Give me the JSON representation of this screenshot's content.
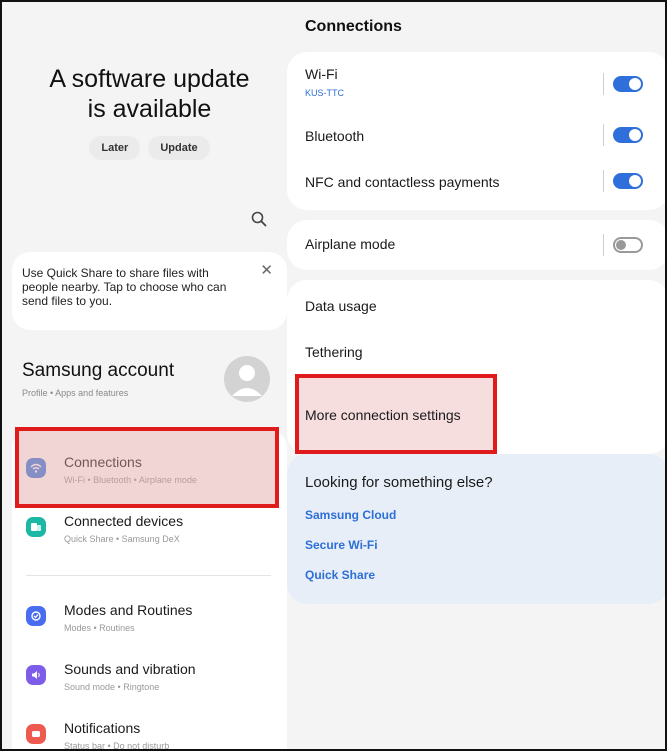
{
  "update": {
    "title_line1": "A software update",
    "title_line2": "is available",
    "later_label": "Later",
    "update_label": "Update"
  },
  "tip": {
    "text": "Use Quick Share to share files with people nearby. Tap to choose who can send files to you.",
    "close": "✕"
  },
  "account": {
    "title": "Samsung account",
    "subtitle": "Profile • Apps and features"
  },
  "settings_items": [
    {
      "title": "Connections",
      "subtitle": "Wi-Fi • Bluetooth • Airplane mode",
      "icon": "wifi-icon",
      "color": "#3b82e6"
    },
    {
      "title": "Connected devices",
      "subtitle": "Quick Share • Samsung DeX",
      "icon": "connected-devices-icon",
      "color": "#1db7a6"
    },
    {
      "title": "Modes and Routines",
      "subtitle": "Modes • Routines",
      "icon": "modes-icon",
      "color": "#4a6cf0"
    },
    {
      "title": "Sounds and vibration",
      "subtitle": "Sound mode • Ringtone",
      "icon": "sound-icon",
      "color": "#7c5ce8"
    },
    {
      "title": "Notifications",
      "subtitle": "Status bar • Do not disturb",
      "icon": "notifications-icon",
      "color": "#ee5a4f"
    }
  ],
  "right": {
    "header": "Connections",
    "wifi_label": "Wi-Fi",
    "wifi_network": "KUS-TTC",
    "wifi_on": true,
    "bluetooth_label": "Bluetooth",
    "bluetooth_on": true,
    "nfc_label": "NFC and contactless payments",
    "nfc_on": true,
    "airplane_label": "Airplane mode",
    "airplane_on": false,
    "data_usage_label": "Data usage",
    "tethering_label": "Tethering",
    "more_settings_label": "More connection settings",
    "looking_title": "Looking for something else?",
    "links": [
      "Samsung Cloud",
      "Secure Wi-Fi",
      "Quick Share"
    ]
  },
  "colors": {
    "accent": "#2f6fdc",
    "highlight": "#e01b1b",
    "link": "#2c6fd6"
  }
}
